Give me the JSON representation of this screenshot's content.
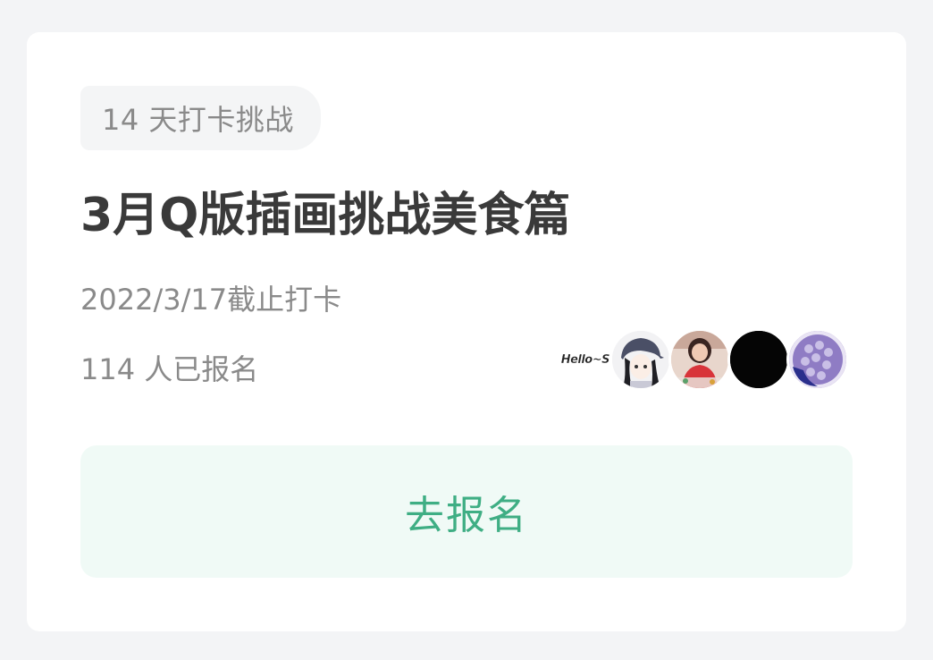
{
  "card": {
    "tag": "14 天打卡挑战",
    "title": "3月Q版插画挑战美食篇",
    "deadline": "2022/3/17截止打卡",
    "participants": "114 人已报名",
    "avatar_stack": {
      "lead_text": "Hello~S",
      "avatars": [
        {
          "icon": "avatar-cartoon-girl-cap"
        },
        {
          "icon": "avatar-person-red"
        },
        {
          "icon": "avatar-black"
        },
        {
          "icon": "avatar-purple-circles"
        }
      ]
    },
    "join_button": "去报名"
  },
  "colors": {
    "background": "#f3f4f6",
    "card": "#ffffff",
    "tag_bg": "#f4f5f6",
    "title": "#3a3a3a",
    "secondary_text": "#8a8a8a",
    "button_bg": "#f0faf6",
    "button_text": "#3fae84"
  }
}
